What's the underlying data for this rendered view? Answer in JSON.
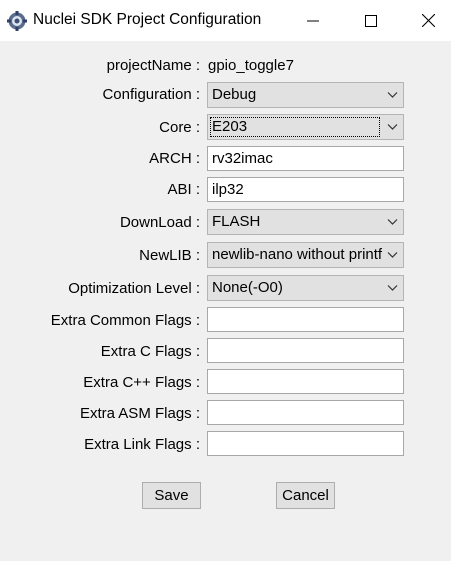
{
  "window": {
    "title": "Nuclei SDK Project Configuration",
    "controls": [
      "minimize",
      "maximize",
      "close"
    ]
  },
  "form": {
    "project_name": {
      "label": "projectName :",
      "value": "gpio_toggle7"
    },
    "configuration": {
      "label": "Configuration :",
      "value": "Debug"
    },
    "core": {
      "label": "Core :",
      "value": "E203"
    },
    "arch": {
      "label": "ARCH :",
      "value": "rv32imac"
    },
    "abi": {
      "label": "ABI :",
      "value": "ilp32"
    },
    "download": {
      "label": "DownLoad :",
      "value": "FLASH"
    },
    "newlib": {
      "label": "NewLIB :",
      "value": "newlib-nano without printf float"
    },
    "optimization": {
      "label": "Optimization Level :",
      "value": "None(-O0)"
    },
    "extra_common_flags": {
      "label": "Extra Common Flags :",
      "value": ""
    },
    "extra_c_flags": {
      "label": "Extra C Flags :",
      "value": ""
    },
    "extra_cpp_flags": {
      "label": "Extra C++ Flags :",
      "value": ""
    },
    "extra_asm_flags": {
      "label": "Extra ASM Flags :",
      "value": ""
    },
    "extra_link_flags": {
      "label": "Extra Link Flags :",
      "value": ""
    }
  },
  "buttons": {
    "save": "Save",
    "cancel": "Cancel"
  },
  "icons": {
    "app": "gear-icon",
    "minimize": "minimize-icon",
    "maximize": "maximize-icon",
    "close": "close-icon",
    "dropdown": "chevron-down-icon"
  }
}
